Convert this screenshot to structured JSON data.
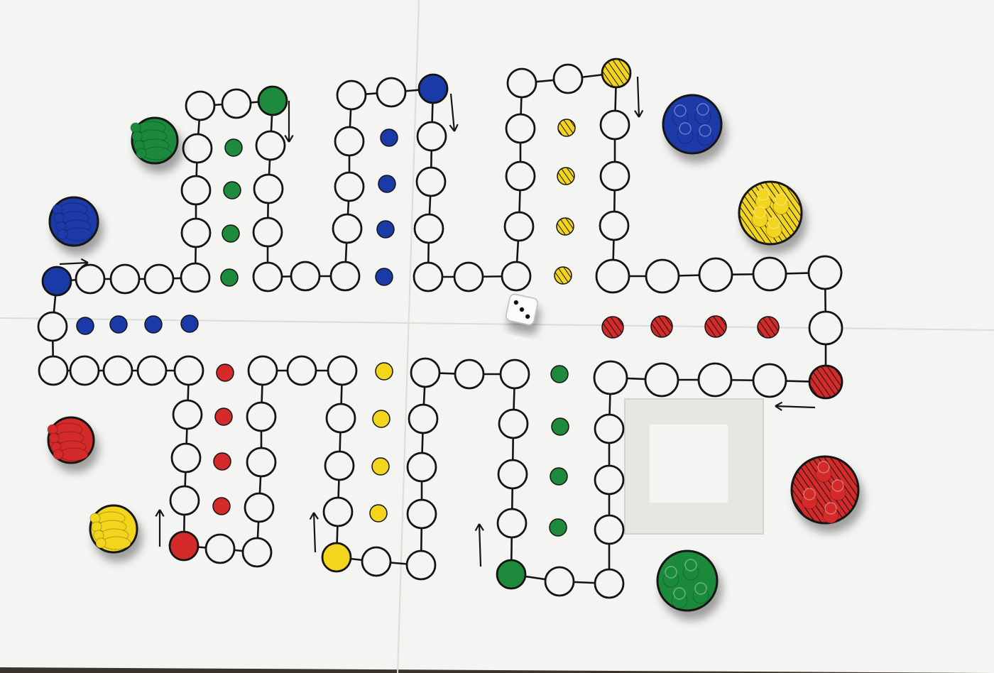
{
  "colors": {
    "paper": "#f4f4f2",
    "line": "#141414",
    "green": "#1e8a3c",
    "blue": "#1a3aa8",
    "yellow": "#f2d51c",
    "red": "#d42a2a"
  },
  "game": {
    "players": [
      "blue",
      "green",
      "yellow",
      "red"
    ],
    "pieces_per_player": 4,
    "dice_value": 3
  }
}
